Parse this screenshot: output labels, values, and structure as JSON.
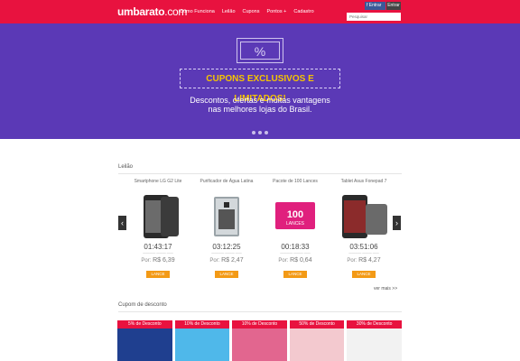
{
  "header": {
    "logo": "umbarato",
    "logo_suffix": ".com",
    "nav": [
      "Como Funciona",
      "Leilão",
      "Cupons",
      "Pontos +",
      "Cadastro"
    ],
    "facebook_label": "Entrar",
    "enter_label": "Entrar",
    "search_placeholder": "Pesquisar"
  },
  "hero": {
    "ticket_symbol": "%",
    "title": "CUPONS EXCLUSIVOS E LIMITADOS!",
    "subtitle_line1": "Descontos, ofertas e muitas vantagens",
    "subtitle_line2": "nas melhores lojas do Brasil."
  },
  "auction": {
    "title": "Leilão",
    "see_more": "ver mais >>",
    "products": [
      {
        "name": "Smartphone LG G2 Lite",
        "timer": "01:43:17",
        "price_label": "Por:",
        "price": "R$ 6,39",
        "button": "LANCE"
      },
      {
        "name": "Purificador de Água Latina",
        "timer": "03:12:25",
        "price_label": "Por:",
        "price": "R$ 2,47",
        "button": "LANCE"
      },
      {
        "name": "Pacote de 100 Lances",
        "timer": "00:18:33",
        "price_label": "Por:",
        "price": "R$ 0,64",
        "button": "LANCE",
        "card_number": "100",
        "card_text": "LANCES"
      },
      {
        "name": "Tablet Asus Fonepad 7",
        "timer": "03:51:06",
        "price_label": "Por:",
        "price": "R$ 4,27",
        "button": "LANCE"
      }
    ]
  },
  "coupons_section": {
    "title": "Cupom de desconto",
    "items": [
      {
        "tag": "5% de Desconto",
        "color": "#1f3f8f"
      },
      {
        "tag": "10% de Desconto",
        "color": "#4fb8ea"
      },
      {
        "tag": "10% de Desconto",
        "color": "#e2668f"
      },
      {
        "tag": "50% de Desconto",
        "color": "#f3c9cf"
      },
      {
        "tag": "30% de Desconto",
        "color": "#f2f2f2"
      }
    ]
  },
  "colors": {
    "header": "#e8123f",
    "hero": "#5b39b6",
    "accent": "#f5c400",
    "button": "#f39a16"
  }
}
